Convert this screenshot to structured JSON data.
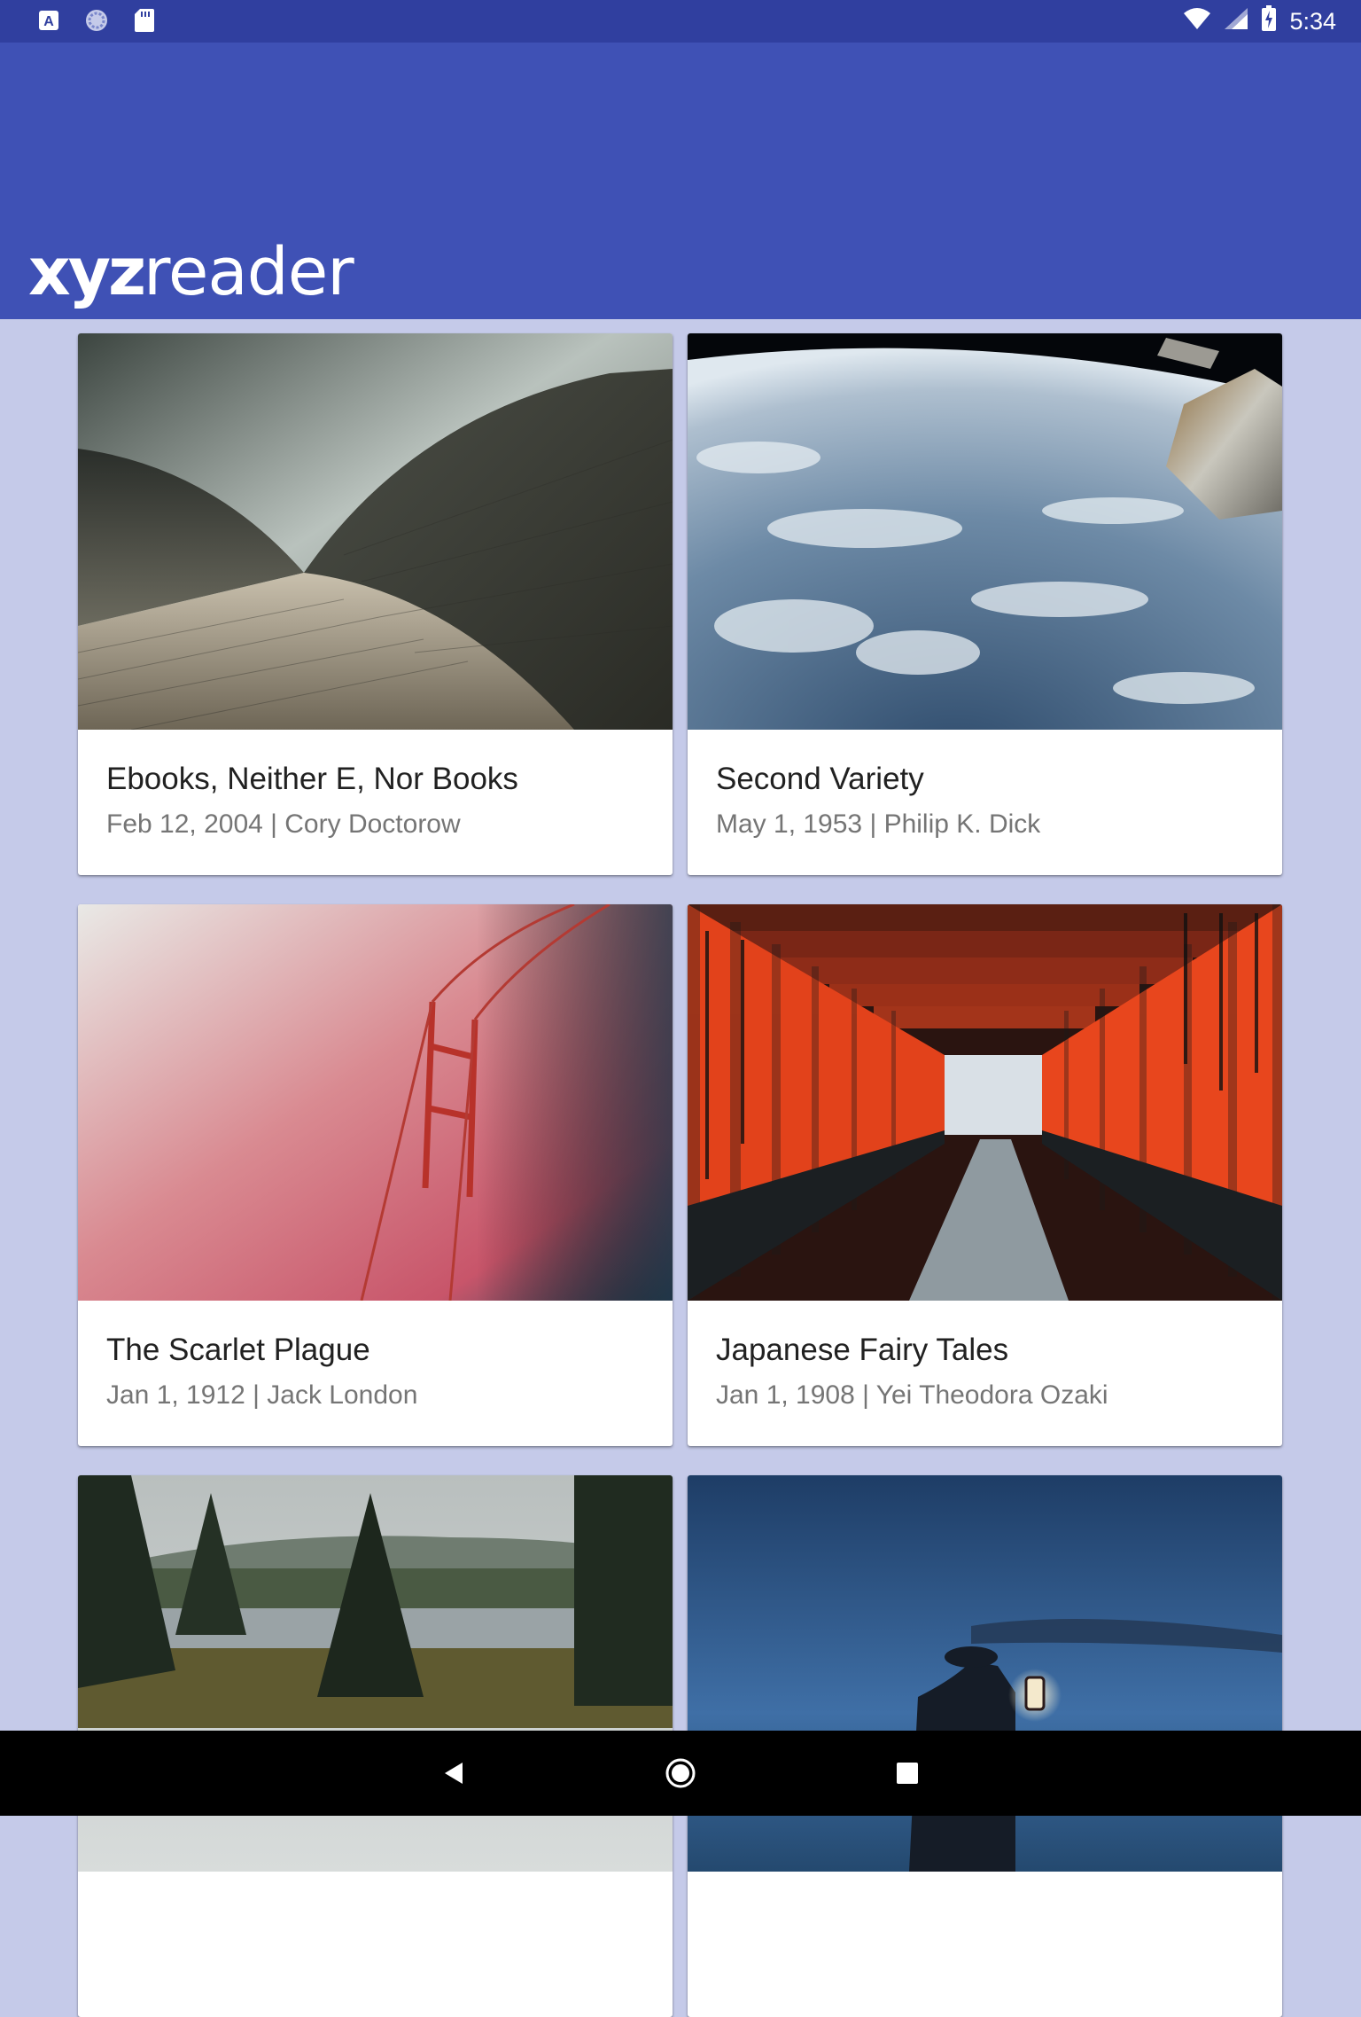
{
  "status_bar": {
    "time": "5:34",
    "left_icons": [
      "app-a-icon",
      "sync-icon",
      "sd-card-icon"
    ],
    "right_icons": [
      "wifi-icon",
      "signal-icon",
      "battery-charging-icon"
    ]
  },
  "app_bar": {
    "logo_bold": "xyz",
    "logo_regular": "reader",
    "color": "#3f51b5"
  },
  "articles": [
    {
      "title": "Ebooks, Neither E, Nor Books",
      "meta": "Feb 12, 2004 | Cory Doctorow",
      "image": "opera-house-roof-photo"
    },
    {
      "title": "Second Variety",
      "meta": "May 1, 1953 | Philip K. Dick",
      "image": "earth-from-space-photo"
    },
    {
      "title": "The Scarlet Plague",
      "meta": "Jan 1, 1912 | Jack London",
      "image": "golden-gate-fog-photo"
    },
    {
      "title": "Japanese Fairy Tales",
      "meta": "Jan 1, 1908 | Yei Theodora Ozaki",
      "image": "torii-gates-photo"
    },
    {
      "title": "",
      "meta": "",
      "image": "forest-lake-photo"
    },
    {
      "title": "",
      "meta": "",
      "image": "lantern-night-photo"
    }
  ],
  "nav_bar": {
    "buttons": [
      "back-icon",
      "home-icon",
      "recents-icon"
    ]
  }
}
